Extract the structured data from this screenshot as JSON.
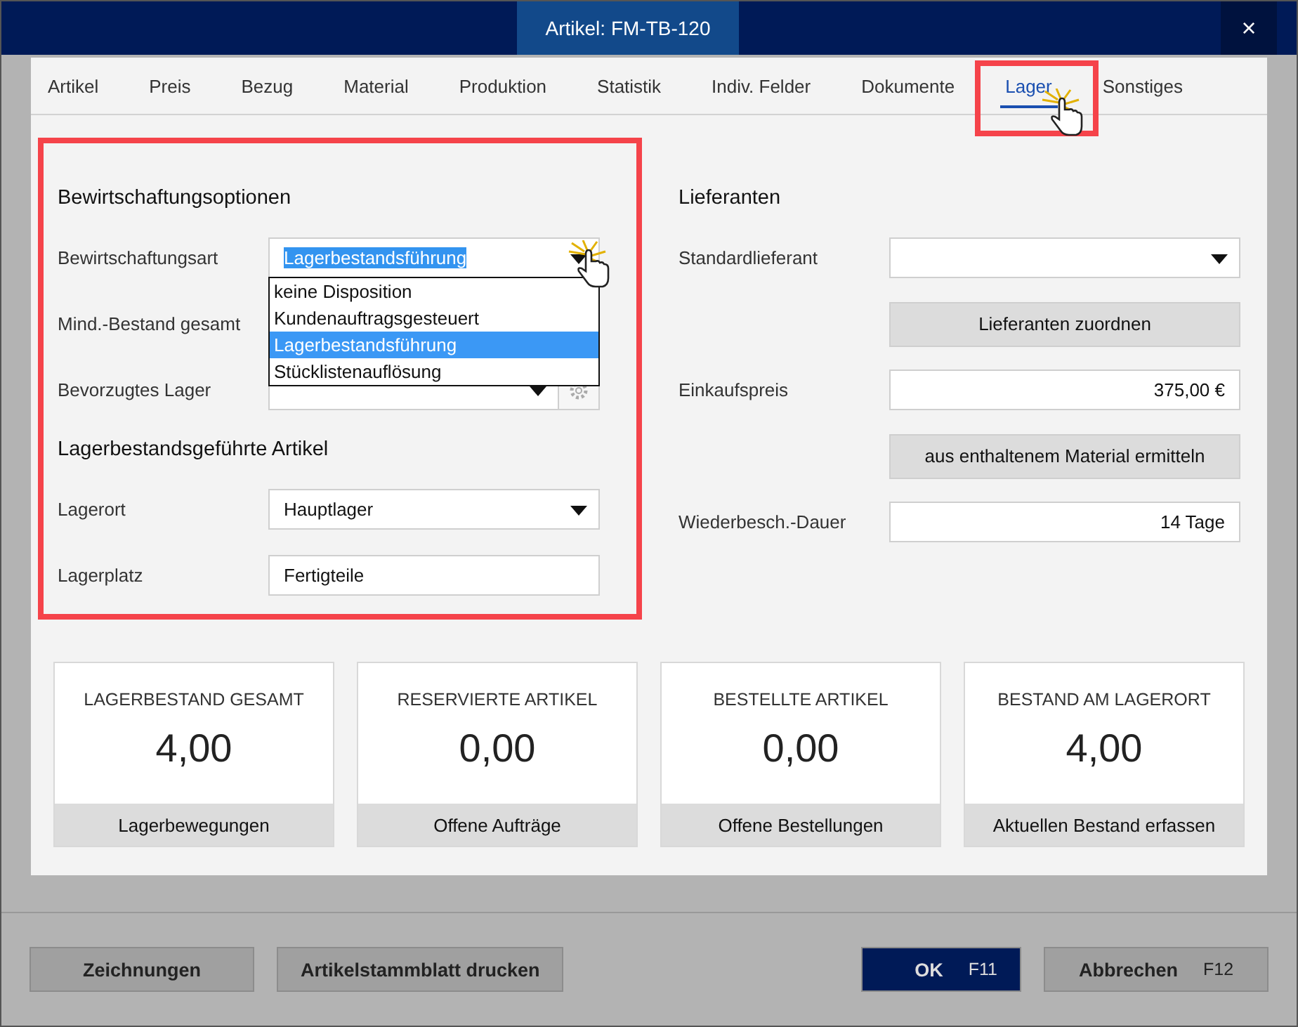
{
  "window": {
    "title": "Artikel: FM-TB-120",
    "close": "×"
  },
  "tabs": [
    {
      "label": "Artikel",
      "selected": false,
      "highlighted": false
    },
    {
      "label": "Preis",
      "selected": false,
      "highlighted": false
    },
    {
      "label": "Bezug",
      "selected": false,
      "highlighted": false
    },
    {
      "label": "Material",
      "selected": false,
      "highlighted": false
    },
    {
      "label": "Produktion",
      "selected": false,
      "highlighted": false
    },
    {
      "label": "Statistik",
      "selected": false,
      "highlighted": false
    },
    {
      "label": "Indiv. Felder",
      "selected": false,
      "highlighted": false
    },
    {
      "label": "Dokumente",
      "selected": false,
      "highlighted": false
    },
    {
      "label": "Lager",
      "selected": true,
      "highlighted": true
    },
    {
      "label": "Sonstiges",
      "selected": false,
      "highlighted": false
    }
  ],
  "left": {
    "highlighted": true,
    "sections": [
      {
        "title": "Bewirtschaftungsoptionen",
        "fields": [
          {
            "label": "Bewirtschaftungsart",
            "kind": "select",
            "value": "Lagerbestandsführung",
            "text_selected": true,
            "options": [
              {
                "label": "keine Disposition",
                "selected": false
              },
              {
                "label": "Kundenauftragsgesteuert",
                "selected": false
              },
              {
                "label": "Lagerbestandsführung",
                "selected": true
              },
              {
                "label": "Stücklistenauflösung",
                "selected": false
              }
            ]
          },
          {
            "label": "Mind.-Bestand gesamt",
            "kind": "covered"
          },
          {
            "label": "Bevorzugtes Lager",
            "kind": "select_gear"
          }
        ]
      },
      {
        "title": "Lagerbestandsgeführte Artikel",
        "fields": [
          {
            "label": "Lagerort",
            "kind": "select",
            "value": "Hauptlager"
          },
          {
            "label": "Lagerplatz",
            "kind": "input",
            "value": "Fertigteile"
          }
        ]
      }
    ]
  },
  "right": {
    "title": "Lieferanten",
    "fields": [
      {
        "label": "Standardlieferant",
        "kind": "select"
      },
      {
        "kind": "button",
        "value": "Lieferanten zuordnen"
      },
      {
        "label": "Einkaufspreis",
        "kind": "number",
        "value": "375,00 €"
      },
      {
        "kind": "button",
        "value": "aus enthaltenem Material ermitteln"
      },
      {
        "label": "Wiederbesch.-Dauer",
        "kind": "number",
        "value": "14 Tage"
      }
    ]
  },
  "cards": [
    {
      "title": "LAGERBESTAND GESAMT",
      "value": "4,00",
      "action": "Lagerbewegungen"
    },
    {
      "title": "RESERVIERTE ARTIKEL",
      "value": "0,00",
      "action": "Offene Aufträge"
    },
    {
      "title": "BESTELLTE ARTIKEL",
      "value": "0,00",
      "action": "Offene Bestellungen"
    },
    {
      "title": "BESTAND AM LAGERORT",
      "value": "4,00",
      "action": "Aktuellen Bestand erfassen"
    }
  ],
  "footer": {
    "left": [
      {
        "label": "Zeichnungen",
        "kind": "secondary"
      },
      {
        "label": "Artikelstammblatt drucken",
        "kind": "secondary"
      }
    ],
    "right": [
      {
        "label": "OK",
        "shortcut": "F11",
        "kind": "primary"
      },
      {
        "label": "Abbrechen",
        "shortcut": "F12",
        "kind": "secondary"
      }
    ]
  }
}
